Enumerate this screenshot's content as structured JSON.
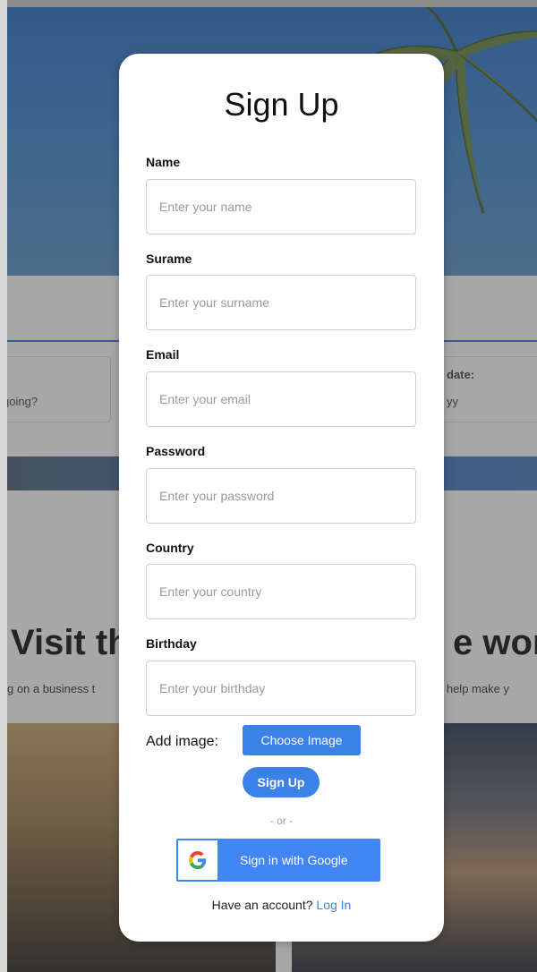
{
  "background": {
    "visit_title_left": "Visit th",
    "visit_title_right": "e worl",
    "visit_sub_left": "g on a business t",
    "visit_sub_right": "o help make y",
    "search_left_placeholder": "going?",
    "search_right_label": "date:",
    "search_right_placeholder": "yy"
  },
  "modal": {
    "title": "Sign Up",
    "fields": [
      {
        "label": "Name",
        "placeholder": "Enter your name"
      },
      {
        "label": "Surame",
        "placeholder": "Enter your surname"
      },
      {
        "label": "Email",
        "placeholder": "Enter your email"
      },
      {
        "label": "Password",
        "placeholder": "Enter your password"
      },
      {
        "label": "Country",
        "placeholder": "Enter your country"
      },
      {
        "label": "Birthday",
        "placeholder": "Enter your birthday"
      }
    ],
    "add_image_label": "Add image:",
    "choose_image_button": "Choose Image",
    "signup_button": "Sign Up",
    "or_text": "- or -",
    "google_button": "Sign in with Google",
    "have_account_text": "Have an account?",
    "login_link": "Log In"
  },
  "colors": {
    "accent": "#3b82e8",
    "google_blue": "#4285f4"
  }
}
